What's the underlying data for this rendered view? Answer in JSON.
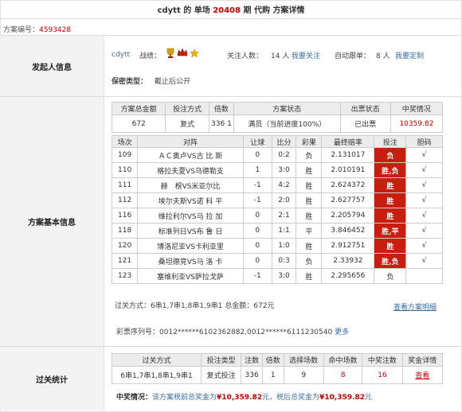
{
  "header": {
    "user": "cdytt",
    "title_parts": [
      "的",
      "单场",
      "20408",
      "期",
      "代购",
      "方案详情"
    ]
  },
  "plan_number": {
    "label": "方案编号：",
    "value": "4593428"
  },
  "sponsor": {
    "section_label": "发起人信息",
    "username": "cdytt",
    "record_label": "战绩：",
    "followers_label": "关注人数：",
    "followers_count": "14 人",
    "follow_link": "我要关注",
    "auto_follow_label": "自动跟单：",
    "auto_follow_count": "8 人",
    "customize_link": "我要定制",
    "secrecy_label": "保密类型：",
    "secrecy_value": "截止后公开"
  },
  "plan_info": {
    "section_label": "方案基本信息",
    "summary_headers": [
      "方案总金额",
      "投注方式",
      "倍数",
      "方案状态",
      "出票状态",
      "中奖情况"
    ],
    "summary_values": {
      "amount": "672",
      "method": "复式",
      "count": "336",
      "multiple": "1",
      "status": "满员（当前进度100%）",
      "ticket_status": "已出票",
      "prize": "10359.82"
    },
    "match_headers": [
      "场次",
      "对阵",
      "让球",
      "比分",
      "彩果",
      "最终赔率",
      "投注",
      "胆码"
    ],
    "matches": [
      {
        "no": "109",
        "match": "ＡＣ奥卢VS古 比 斯",
        "handicap": "0",
        "score": "0:2",
        "result": "负",
        "odds": "2.131017",
        "bet": "负",
        "banker": "√",
        "bet_highlight": true
      },
      {
        "no": "110",
        "match": "格拉夫夏VS乌德勒支",
        "handicap": "1",
        "score": "3:0",
        "result": "胜",
        "odds": "2.010191",
        "bet": "胜,负",
        "banker": "√",
        "bet_highlight": true
      },
      {
        "no": "111",
        "match": "赫　根VS米亚尔比",
        "handicap": "-1",
        "score": "4:2",
        "result": "胜",
        "odds": "2.624372",
        "bet": "胜",
        "banker": "√",
        "bet_highlight": true
      },
      {
        "no": "112",
        "match": "埃尔夫斯VS诺 科 平",
        "handicap": "-1",
        "score": "2:0",
        "result": "胜",
        "odds": "2.627757",
        "bet": "胜",
        "banker": "√",
        "bet_highlight": true
      },
      {
        "no": "116",
        "match": "维拉利尔VS马 拉 加",
        "handicap": "0",
        "score": "2:1",
        "result": "胜",
        "odds": "2.205794",
        "bet": "胜",
        "banker": "√",
        "bet_highlight": true
      },
      {
        "no": "118",
        "match": "标准列日VS布 鲁 日",
        "handicap": "0",
        "score": "1:1",
        "result": "平",
        "odds": "3.846452",
        "bet": "胜,平",
        "banker": "√",
        "bet_highlight": true
      },
      {
        "no": "120",
        "match": "博洛尼亚VS卡利亚里",
        "handicap": "0",
        "score": "1:0",
        "result": "胜",
        "odds": "2.912751",
        "bet": "胜",
        "banker": "√",
        "bet_highlight": true
      },
      {
        "no": "121",
        "match": "桑坦德竞VS马 洛 卡",
        "handicap": "0",
        "score": "0:3",
        "result": "负",
        "odds": "2.33932",
        "bet": "胜,负",
        "banker": "√",
        "bet_highlight": true
      },
      {
        "no": "123",
        "match": "塞维利亚VS萨拉戈萨",
        "handicap": "-1",
        "score": "3:0",
        "result": "胜",
        "odds": "2.295656",
        "bet": "负",
        "banker": "",
        "bet_highlight": false
      }
    ],
    "pass_summary": "过关方式：6串1,7串1,8串1,9串1 总金额：672元",
    "view_details_link": "查看方案明细",
    "lottery_serial_label": "彩票序列号：",
    "lottery_serial_value": "0012******6102362882,0012******6111230540",
    "more_link": "更多"
  },
  "pass_stats": {
    "section_label": "过关统计",
    "headers": [
      "过关方式",
      "投注类型",
      "注数",
      "倍数",
      "选择场数",
      "命中场数",
      "中奖注数",
      "奖金详情"
    ],
    "row": {
      "pass": "6串1,7串1,8串1,9串1",
      "type": "复式投注",
      "count": "336",
      "multiple": "1",
      "selected": "9",
      "hits": "8",
      "prize_count": "16",
      "view_link": "查看"
    },
    "prize_text_label": "中奖情况：",
    "prize_text_1": "该方案税前总奖金为",
    "pre_tax": "¥10,359.82",
    "prize_text_2": "元，税后总奖金为",
    "after_tax": "¥10,359.82",
    "prize_text_3": "元"
  },
  "colors": {
    "accent_red": "#c81e10",
    "link_blue": "#3a6ea5"
  }
}
